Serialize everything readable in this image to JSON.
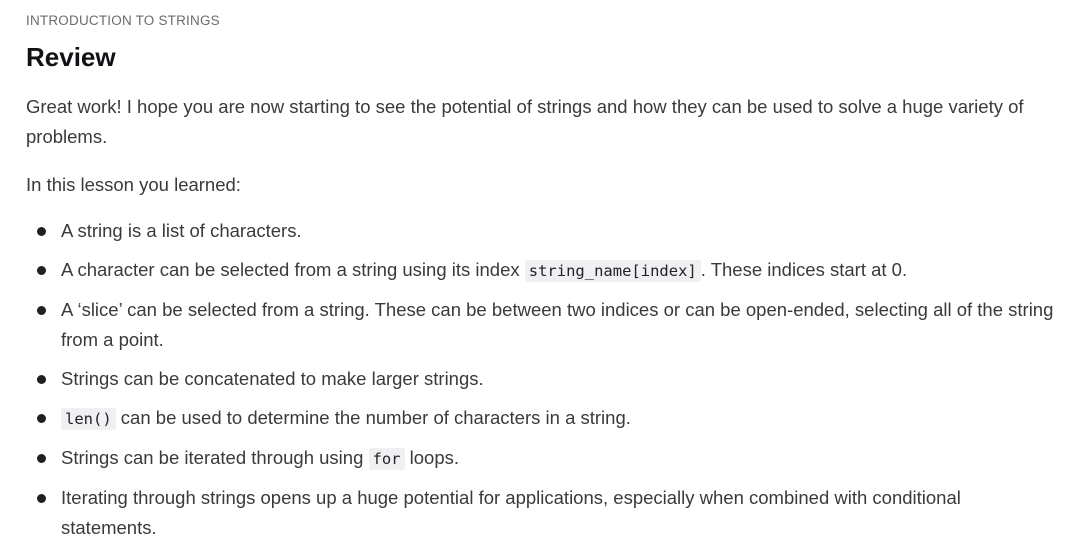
{
  "lesson": {
    "section": "INTRODUCTION TO STRINGS",
    "title": "Review",
    "intro": "Great work! I hope you are now starting to see the potential of strings and how they can be used to solve a huge variety of problems.",
    "lead": "In this lesson you learned:"
  },
  "summary": {
    "item1": "A string is a list of characters.",
    "item2": {
      "before": "A character can be selected from a string using its index ",
      "code": "string_name[index]",
      "after": ". These indices start at 0."
    },
    "item3": "A ‘slice’ can be selected from a string. These can be between two indices or can be open-ended, selecting all of the string from a point.",
    "item4": "Strings can be concatenated to make larger strings.",
    "item5": {
      "code": "len()",
      "after": " can be used to determine the number of characters in a string."
    },
    "item6": {
      "before": "Strings can be iterated through using ",
      "code": "for",
      "after": " loops."
    },
    "item7": "Iterating through strings opens up a huge potential for applications, especially when combined with conditional statements."
  }
}
